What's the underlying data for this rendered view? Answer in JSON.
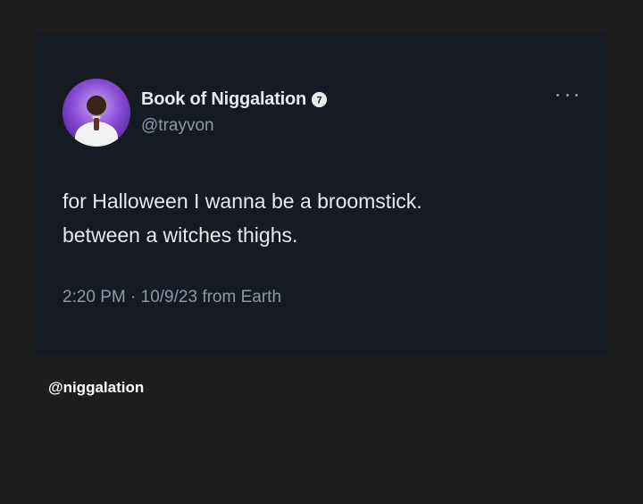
{
  "tweet": {
    "display_name": "Book of Niggalation",
    "badge_glyph": "7",
    "handle": "@trayvon",
    "text_line1": "for Halloween I wanna be a broomstick.",
    "text_line2": "between a witches thighs.",
    "timestamp": "2:20 PM · 10/9/23 from Earth"
  },
  "footer": {
    "credit": "@niggalation"
  },
  "colors": {
    "page_bg": "#1e1e1e",
    "card_bg": "#151a23",
    "primary_text": "#e7e9ea",
    "secondary_text": "#8b98a5",
    "avatar_glow": "#8a4cd6"
  },
  "icons": {
    "more": "ellipsis-icon",
    "badge": "verified-badge-icon"
  }
}
